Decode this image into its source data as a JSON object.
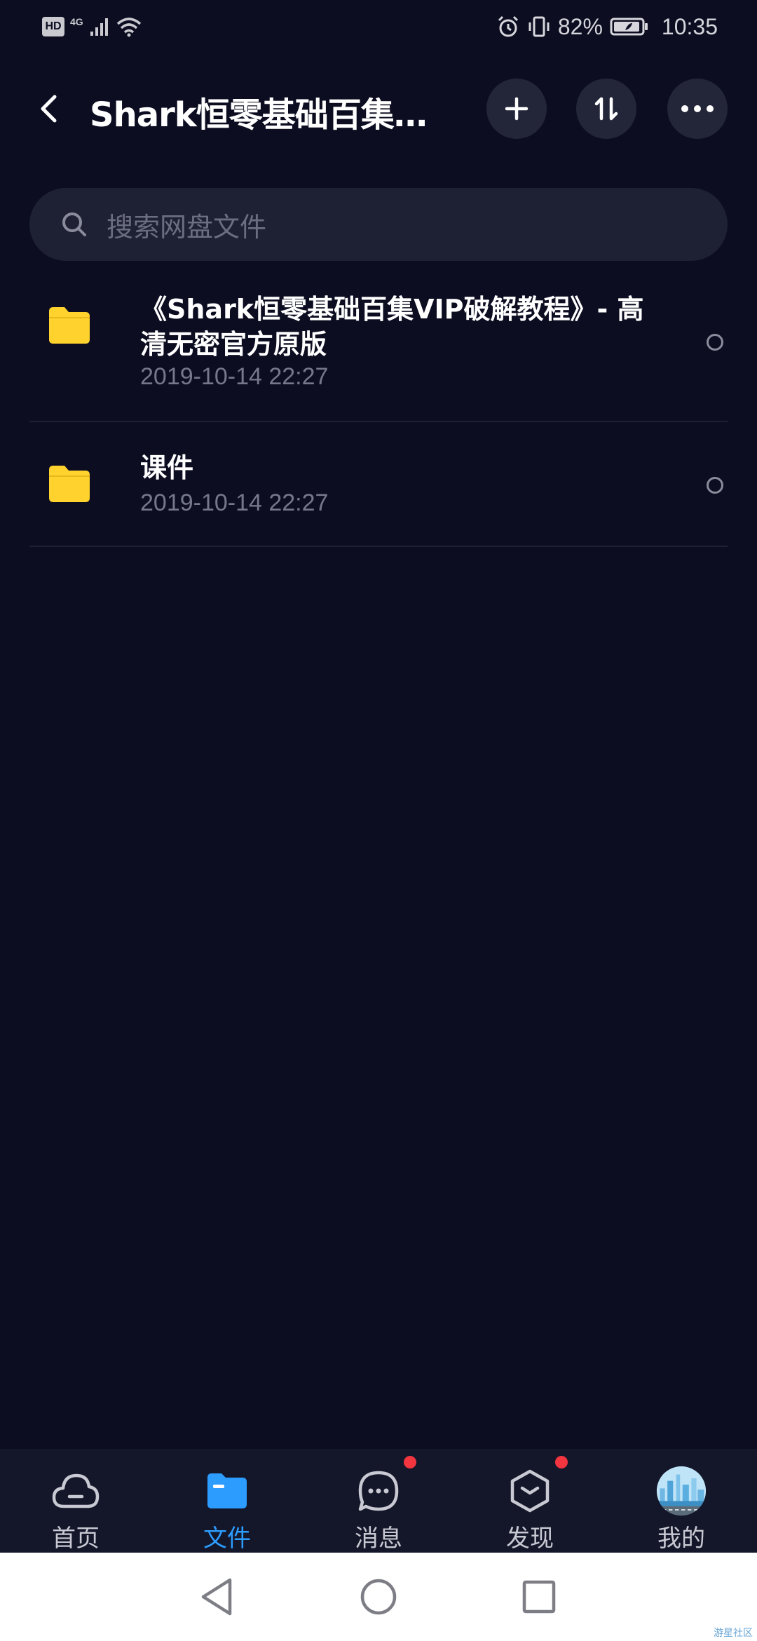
{
  "status_bar": {
    "hd": "HD",
    "network": "4G",
    "battery_pct": "82%",
    "time": "10:35"
  },
  "header": {
    "title": "Shark恒零基础百集VI...",
    "icons": [
      "back-arrow-icon",
      "plus-icon",
      "sort-icon",
      "more-icon"
    ]
  },
  "search": {
    "placeholder": "搜索网盘文件"
  },
  "files": [
    {
      "name": "《Shark恒零基础百集VIP破解教程》- 高清无密官方原版",
      "date": "2019-10-14  22:27",
      "icon": "folder-icon"
    },
    {
      "name": "课件",
      "date": "2019-10-14  22:27",
      "icon": "folder-icon"
    }
  ],
  "bottom_nav": [
    {
      "label": "首页",
      "icon": "cloud-icon",
      "active": false
    },
    {
      "label": "文件",
      "icon": "folder-icon",
      "active": true
    },
    {
      "label": "消息",
      "icon": "chat-icon",
      "active": false,
      "badge": true
    },
    {
      "label": "发现",
      "icon": "cube-icon",
      "active": false,
      "badge": true
    },
    {
      "label": "我的",
      "icon": "avatar",
      "active": false
    }
  ],
  "watermark": "游星社区",
  "colors": {
    "background": "#0c0d21",
    "accent": "#2c9cff",
    "folder": "#ffd22e",
    "badge": "#f2353f"
  }
}
